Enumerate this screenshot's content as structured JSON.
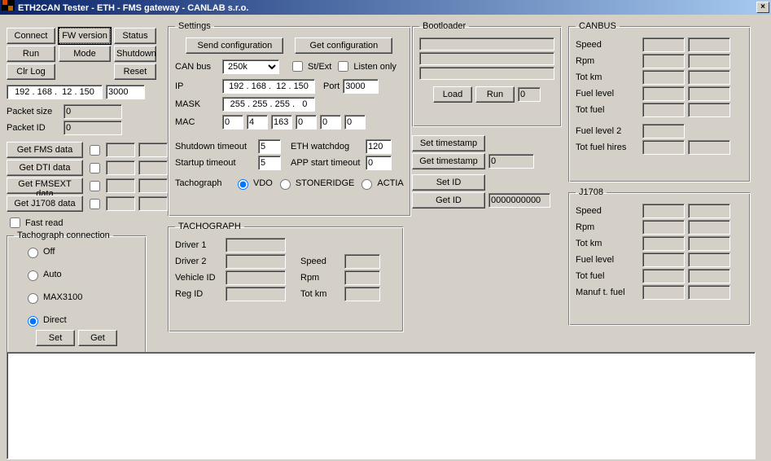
{
  "title": "ETH2CAN Tester     -     ETH - FMS gateway     -     CANLAB s.r.o.",
  "btn": {
    "connect": "Connect",
    "fwver": "FW version",
    "status": "Status",
    "run": "Run",
    "mode": "Mode",
    "shutdown": "Shutdown",
    "clrlog": "Clr Log",
    "reset": "Reset",
    "getfms": "Get FMS data",
    "getdti": "Get DTI data",
    "getfmsext": "Get FMSEXT data",
    "getj1708": "Get J1708 data",
    "set": "Set",
    "get": "Get",
    "sendcfg": "Send configuration",
    "getcfg": "Get configuration",
    "bl_load": "Load",
    "bl_run": "Run",
    "settstamp": "Set timestamp",
    "gettstamp": "Get timestamp",
    "setid": "Set ID",
    "getid": "Get ID"
  },
  "left": {
    "ip": "192 . 168 .  12 . 150",
    "port": "3000",
    "packet_size_lbl": "Packet size",
    "packet_size_val": "0",
    "packet_id_lbl": "Packet ID",
    "packet_id_val": "0",
    "fastread": "Fast read"
  },
  "tachoconn": {
    "legend": "Tachograph connection",
    "off": "Off",
    "auto": "Auto",
    "max": "MAX3100",
    "direct": "Direct"
  },
  "settings": {
    "legend": "Settings",
    "canbus_lbl": "CAN bus",
    "canbus_val": "250k",
    "stext": "St/Ext",
    "listen": "Listen only",
    "ip_lbl": "IP",
    "ip_val": "192 . 168 .  12 . 150",
    "port_lbl": "Port",
    "port_val": "3000",
    "mask_lbl": "MASK",
    "mask_val": "255 . 255 . 255 .   0",
    "mac_lbl": "MAC",
    "mac": [
      "0",
      "4",
      "163",
      "0",
      "0",
      "0"
    ],
    "sd_to_lbl": "Shutdown timeout",
    "sd_to_val": "5",
    "su_to_lbl": "Startup timeout",
    "su_to_val": "5",
    "wd_lbl": "ETH watchdog",
    "wd_val": "120",
    "app_lbl": "APP start timeout",
    "app_val": "0",
    "tacho_lbl": "Tachograph",
    "vdo": "VDO",
    "stoneridge": "STONERIDGE",
    "actia": "ACTIA"
  },
  "tachograph": {
    "legend": "TACHOGRAPH",
    "d1": "Driver 1",
    "d2": "Driver 2",
    "vid": "Vehicle ID",
    "rid": "Reg ID",
    "speed": "Speed",
    "rpm": "Rpm",
    "totkm": "Tot km"
  },
  "bootloader": {
    "legend": "Bootloader",
    "val": "0",
    "tstamp_val": "0",
    "id_val": "0000000000"
  },
  "canbus": {
    "legend": "CANBUS",
    "speed": "Speed",
    "rpm": "Rpm",
    "totkm": "Tot km",
    "fuel": "Fuel level",
    "totfuel": "Tot fuel",
    "fuel2": "Fuel level 2",
    "totfuelh": "Tot fuel hires"
  },
  "j1708": {
    "legend": "J1708",
    "speed": "Speed",
    "rpm": "Rpm",
    "totkm": "Tot km",
    "fuel": "Fuel level",
    "totfuel": "Tot fuel",
    "manuf": "Manuf t. fuel"
  }
}
